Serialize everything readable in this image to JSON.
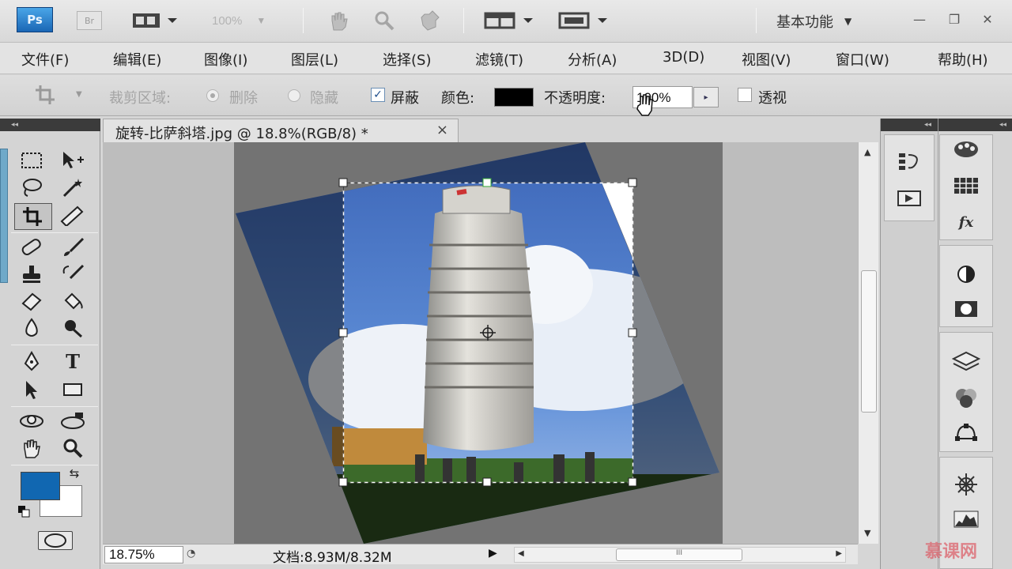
{
  "titlebar": {
    "app_logo": "Ps",
    "bridge_logo": "Br",
    "zoom_value": "100%",
    "workspace_label": "基本功能",
    "icons": [
      "film-strip-icon",
      "hand-icon",
      "zoom-icon",
      "rotate-view-icon",
      "arrange-documents-icon",
      "screen-mode-icon"
    ]
  },
  "menu": {
    "items": [
      "文件(F)",
      "编辑(E)",
      "图像(I)",
      "图层(L)",
      "选择(S)",
      "滤镜(T)",
      "分析(A)",
      "3D(D)",
      "视图(V)",
      "窗口(W)",
      "帮助(H)"
    ]
  },
  "options": {
    "crop_area_label": "裁剪区域:",
    "delete_label": "删除",
    "hide_label": "隐藏",
    "shield_label": "屏蔽",
    "shield_checked": true,
    "color_label": "颜色:",
    "shield_color": "#000000",
    "opacity_label": "不透明度:",
    "opacity_value": "100%",
    "perspective_label": "透视",
    "perspective_checked": false
  },
  "document": {
    "tab_title": "旋转-比萨斜塔.jpg @ 18.8%(RGB/8) *",
    "close_glyph": "×",
    "zoom_field": "18.75%",
    "doc_info": "文档:8.93M/8.32M"
  },
  "tools": {
    "foreground_color": "#1167b1",
    "background_color": "#ffffff"
  },
  "watermark": "慕课网"
}
